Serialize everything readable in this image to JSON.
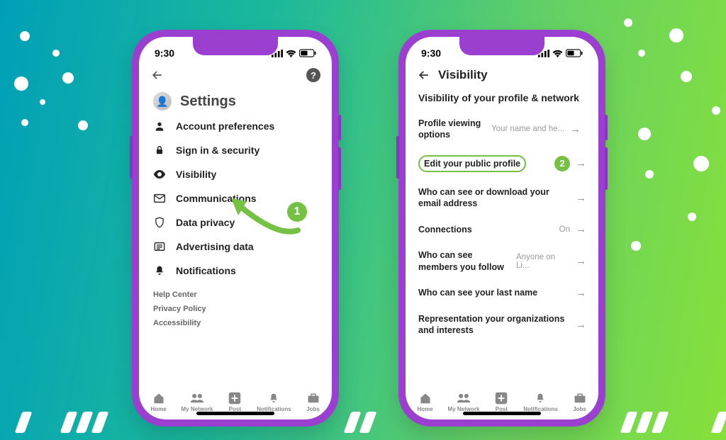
{
  "status": {
    "time": "9:30"
  },
  "phone1": {
    "settings_title": "Settings",
    "menu": [
      {
        "label": "Account preferences"
      },
      {
        "label": "Sign in & security"
      },
      {
        "label": "Visibility"
      },
      {
        "label": "Communications"
      },
      {
        "label": "Data privacy"
      },
      {
        "label": "Advertising data"
      },
      {
        "label": "Notifications"
      }
    ],
    "links": [
      "Help Center",
      "Privacy Policy",
      "Accessibility"
    ]
  },
  "phone2": {
    "header": "Visibility",
    "section": "Visibility of your profile & network",
    "rows": [
      {
        "label": "Profile viewing options",
        "value": "Your name and he..."
      },
      {
        "label": "Edit your public profile",
        "value": ""
      },
      {
        "label": "Who can see or download your email address",
        "value": ""
      },
      {
        "label": "Connections",
        "value": "On"
      },
      {
        "label": "Who can see members you follow",
        "value": "Anyone on Li..."
      },
      {
        "label": "Who can see your last name",
        "value": ""
      },
      {
        "label": "Representation your organizations and interests",
        "value": ""
      }
    ]
  },
  "nav": [
    "Home",
    "My Network",
    "Post",
    "Notifications",
    "Jobs"
  ],
  "annotations": {
    "step1": "1",
    "step2": "2"
  }
}
